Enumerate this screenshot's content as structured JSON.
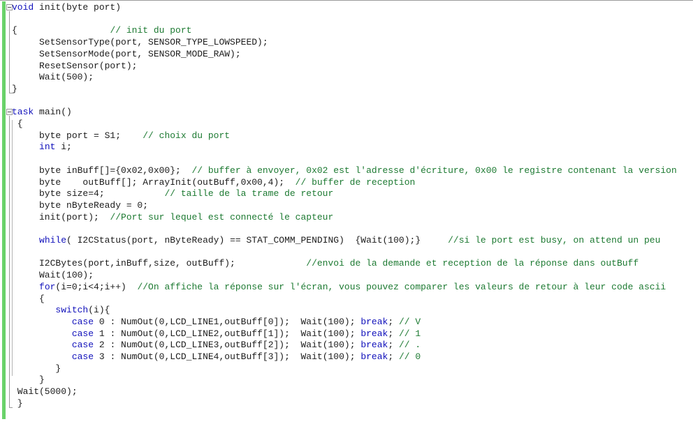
{
  "editor": {
    "app": "code-editor",
    "language": "NXC",
    "colors": {
      "background": "#ffffff",
      "text": "#1c1c1c",
      "keyword": "#1111bb",
      "comment": "#1d7a32",
      "change_bar": "#6ad26a",
      "gutter_line": "#9a9a9a",
      "top_border": "#9a9a9a"
    },
    "gutter": {
      "fold_markers": [
        {
          "name": "fold-marker-init-function",
          "glyph": "minus",
          "line": 0
        },
        {
          "name": "fold-marker-task-main",
          "glyph": "minus",
          "line": 9
        }
      ]
    }
  },
  "code": {
    "lines": [
      {
        "n": 0,
        "indent": 0,
        "segments": [
          {
            "t": "void",
            "c": "kw"
          },
          {
            "t": " init(byte port)",
            "c": "tx"
          }
        ]
      },
      {
        "n": 1,
        "indent": 0,
        "segments": []
      },
      {
        "n": 2,
        "indent": 0,
        "segments": [
          {
            "t": "{                 ",
            "c": "tx"
          },
          {
            "t": "// init du port",
            "c": "cm"
          }
        ]
      },
      {
        "n": 3,
        "indent": 0,
        "segments": [
          {
            "t": "     SetSensorType(port, SENSOR_TYPE_LOWSPEED);",
            "c": "tx"
          }
        ]
      },
      {
        "n": 4,
        "indent": 0,
        "segments": [
          {
            "t": "     SetSensorMode(port, SENSOR_MODE_RAW);",
            "c": "tx"
          }
        ]
      },
      {
        "n": 5,
        "indent": 0,
        "segments": [
          {
            "t": "     ResetSensor(port);",
            "c": "tx"
          }
        ]
      },
      {
        "n": 6,
        "indent": 0,
        "segments": [
          {
            "t": "     Wait(500);",
            "c": "tx"
          }
        ]
      },
      {
        "n": 7,
        "indent": 0,
        "segments": [
          {
            "t": "}",
            "c": "tx"
          }
        ]
      },
      {
        "n": 8,
        "indent": 0,
        "segments": []
      },
      {
        "n": 9,
        "indent": 0,
        "segments": [
          {
            "t": "task",
            "c": "kw"
          },
          {
            "t": " main()",
            "c": "tx"
          }
        ]
      },
      {
        "n": 10,
        "indent": 0,
        "segments": [
          {
            "t": " {",
            "c": "tx"
          }
        ]
      },
      {
        "n": 11,
        "indent": 0,
        "segments": [
          {
            "t": "     byte port = S1;    ",
            "c": "tx"
          },
          {
            "t": "// choix du port",
            "c": "cm"
          }
        ]
      },
      {
        "n": 12,
        "indent": 0,
        "segments": [
          {
            "t": "     ",
            "c": "tx"
          },
          {
            "t": "int",
            "c": "kw"
          },
          {
            "t": " i;",
            "c": "tx"
          }
        ]
      },
      {
        "n": 13,
        "indent": 0,
        "segments": []
      },
      {
        "n": 14,
        "indent": 0,
        "segments": [
          {
            "t": "     byte inBuff[]={0x02,0x00};  ",
            "c": "tx"
          },
          {
            "t": "// buffer à envoyer, 0x02 est l'adresse d'écriture, 0x00 le registre contenant la version",
            "c": "cm"
          }
        ]
      },
      {
        "n": 15,
        "indent": 0,
        "segments": [
          {
            "t": "     byte    outBuff[]; ArrayInit(outBuff,0x00,4);  ",
            "c": "tx"
          },
          {
            "t": "// buffer de reception",
            "c": "cm"
          }
        ]
      },
      {
        "n": 16,
        "indent": 0,
        "segments": [
          {
            "t": "     byte size=4;           ",
            "c": "tx"
          },
          {
            "t": "// taille de la trame de retour",
            "c": "cm"
          }
        ]
      },
      {
        "n": 17,
        "indent": 0,
        "segments": [
          {
            "t": "     byte nByteReady = 0;",
            "c": "tx"
          }
        ]
      },
      {
        "n": 18,
        "indent": 0,
        "segments": [
          {
            "t": "     init(port);  ",
            "c": "tx"
          },
          {
            "t": "//Port sur lequel est connecté le capteur",
            "c": "cm"
          }
        ]
      },
      {
        "n": 19,
        "indent": 0,
        "segments": []
      },
      {
        "n": 20,
        "indent": 0,
        "segments": [
          {
            "t": "     ",
            "c": "tx"
          },
          {
            "t": "while",
            "c": "kw"
          },
          {
            "t": "( I2CStatus(port, nByteReady) == STAT_COMM_PENDING)  {Wait(100);}     ",
            "c": "tx"
          },
          {
            "t": "//si le port est busy, on attend un peu",
            "c": "cm"
          }
        ]
      },
      {
        "n": 21,
        "indent": 0,
        "segments": []
      },
      {
        "n": 22,
        "indent": 0,
        "segments": [
          {
            "t": "     I2CBytes(port,inBuff,size, outBuff);             ",
            "c": "tx"
          },
          {
            "t": "//envoi de la demande et reception de la réponse dans outBuff",
            "c": "cm"
          }
        ]
      },
      {
        "n": 23,
        "indent": 0,
        "segments": [
          {
            "t": "     Wait(100);",
            "c": "tx"
          }
        ]
      },
      {
        "n": 24,
        "indent": 0,
        "segments": [
          {
            "t": "     ",
            "c": "tx"
          },
          {
            "t": "for",
            "c": "kw"
          },
          {
            "t": "(i=0;i<4;i++)  ",
            "c": "tx"
          },
          {
            "t": "//On affiche la réponse sur l'écran, vous pouvez comparer les valeurs de retour à leur code ascii",
            "c": "cm"
          }
        ]
      },
      {
        "n": 25,
        "indent": 0,
        "segments": [
          {
            "t": "     {",
            "c": "tx"
          }
        ]
      },
      {
        "n": 26,
        "indent": 0,
        "segments": [
          {
            "t": "        ",
            "c": "tx"
          },
          {
            "t": "switch",
            "c": "kw"
          },
          {
            "t": "(i){",
            "c": "tx"
          }
        ]
      },
      {
        "n": 27,
        "indent": 0,
        "segments": [
          {
            "t": "           ",
            "c": "tx"
          },
          {
            "t": "case",
            "c": "kw"
          },
          {
            "t": " 0 : NumOut(0,LCD_LINE1,outBuff[0]);  Wait(100); ",
            "c": "tx"
          },
          {
            "t": "break",
            "c": "kw"
          },
          {
            "t": "; ",
            "c": "tx"
          },
          {
            "t": "// V",
            "c": "cm"
          }
        ]
      },
      {
        "n": 28,
        "indent": 0,
        "segments": [
          {
            "t": "           ",
            "c": "tx"
          },
          {
            "t": "case",
            "c": "kw"
          },
          {
            "t": " 1 : NumOut(0,LCD_LINE2,outBuff[1]);  Wait(100); ",
            "c": "tx"
          },
          {
            "t": "break",
            "c": "kw"
          },
          {
            "t": "; ",
            "c": "tx"
          },
          {
            "t": "// 1",
            "c": "cm"
          }
        ]
      },
      {
        "n": 29,
        "indent": 0,
        "segments": [
          {
            "t": "           ",
            "c": "tx"
          },
          {
            "t": "case",
            "c": "kw"
          },
          {
            "t": " 2 : NumOut(0,LCD_LINE3,outBuff[2]);  Wait(100); ",
            "c": "tx"
          },
          {
            "t": "break",
            "c": "kw"
          },
          {
            "t": "; ",
            "c": "tx"
          },
          {
            "t": "// .",
            "c": "cm"
          }
        ]
      },
      {
        "n": 30,
        "indent": 0,
        "segments": [
          {
            "t": "           ",
            "c": "tx"
          },
          {
            "t": "case",
            "c": "kw"
          },
          {
            "t": " 3 : NumOut(0,LCD_LINE4,outBuff[3]);  Wait(100); ",
            "c": "tx"
          },
          {
            "t": "break",
            "c": "kw"
          },
          {
            "t": "; ",
            "c": "tx"
          },
          {
            "t": "// 0",
            "c": "cm"
          }
        ]
      },
      {
        "n": 31,
        "indent": 0,
        "segments": [
          {
            "t": "        }",
            "c": "tx"
          }
        ]
      },
      {
        "n": 32,
        "indent": 0,
        "segments": [
          {
            "t": "     }",
            "c": "tx"
          }
        ]
      },
      {
        "n": 33,
        "indent": 0,
        "segments": [
          {
            "t": " Wait(5000);",
            "c": "tx"
          }
        ]
      },
      {
        "n": 34,
        "indent": 0,
        "segments": [
          {
            "t": " }",
            "c": "tx"
          }
        ]
      }
    ]
  }
}
